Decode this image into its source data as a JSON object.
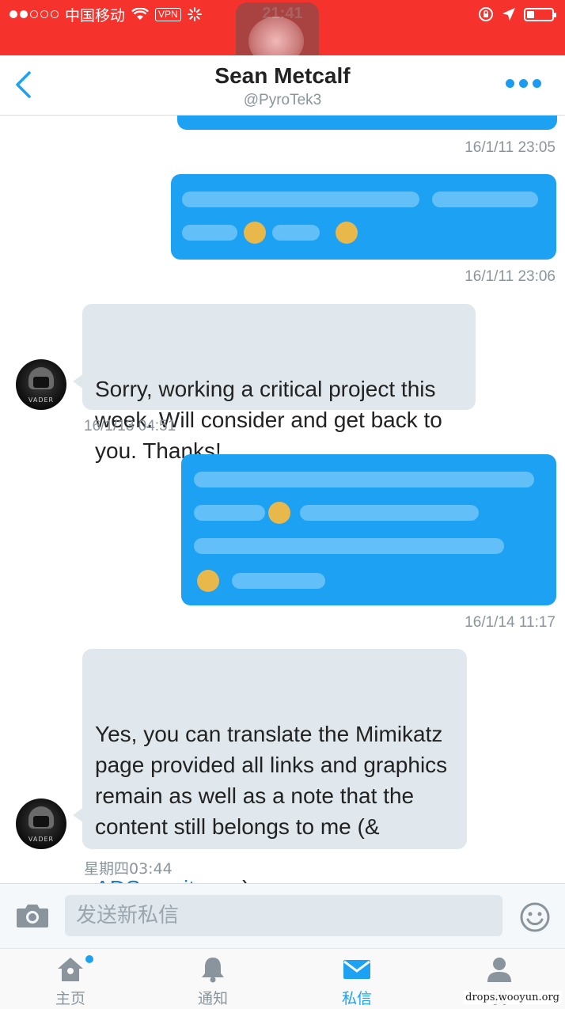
{
  "status_bar": {
    "carrier": "中国移动",
    "vpn_label": "VPN",
    "time": "21:41",
    "signal_bars_filled": 2,
    "signal_bars_total": 5,
    "battery_level": 0.3,
    "background_color": "#f5332c"
  },
  "header": {
    "title": "Sean Metcalf",
    "handle": "@PyroTek3",
    "back_icon": "chevron-left-icon",
    "more_icon": "ellipsis-icon"
  },
  "messages": [
    {
      "direction": "outgoing",
      "content": "blurred",
      "timestamp": "16/1/11 23:05"
    },
    {
      "direction": "outgoing",
      "content": "blurred",
      "timestamp": "16/1/11 23:06"
    },
    {
      "direction": "incoming",
      "text": "Sorry, working a critical project this week. Will consider and get back to you. Thanks!",
      "timestamp": "16/1/13 04:51"
    },
    {
      "direction": "outgoing",
      "content": "blurred",
      "timestamp": "16/1/14 11:17"
    },
    {
      "direction": "incoming",
      "text_before_link": "Yes, you can translate the Mimikatz page provided all links and graphics remain as well as a note that the content still belongs to me (&",
      "link_text": "ADSecurity.org",
      "text_after_link": ")",
      "timestamp": "星期四03:44"
    }
  ],
  "avatar": {
    "caption": "VADER"
  },
  "composer": {
    "placeholder": "发送新私信",
    "camera_icon": "camera-icon",
    "emoji_icon": "smiley-icon"
  },
  "tabs": [
    {
      "label": "主页",
      "icon": "home-icon",
      "has_badge": true,
      "active": false
    },
    {
      "label": "通知",
      "icon": "bell-icon",
      "has_badge": false,
      "active": false
    },
    {
      "label": "私信",
      "icon": "envelope-icon",
      "has_badge": false,
      "active": true
    },
    {
      "label": "我",
      "icon": "person-icon",
      "has_badge": false,
      "active": false
    }
  ],
  "watermark": "drops.wooyun.org",
  "colors": {
    "accent": "#1da1f2",
    "incoming_bubble": "#e1e8ed",
    "timestamp": "#8a949c"
  }
}
